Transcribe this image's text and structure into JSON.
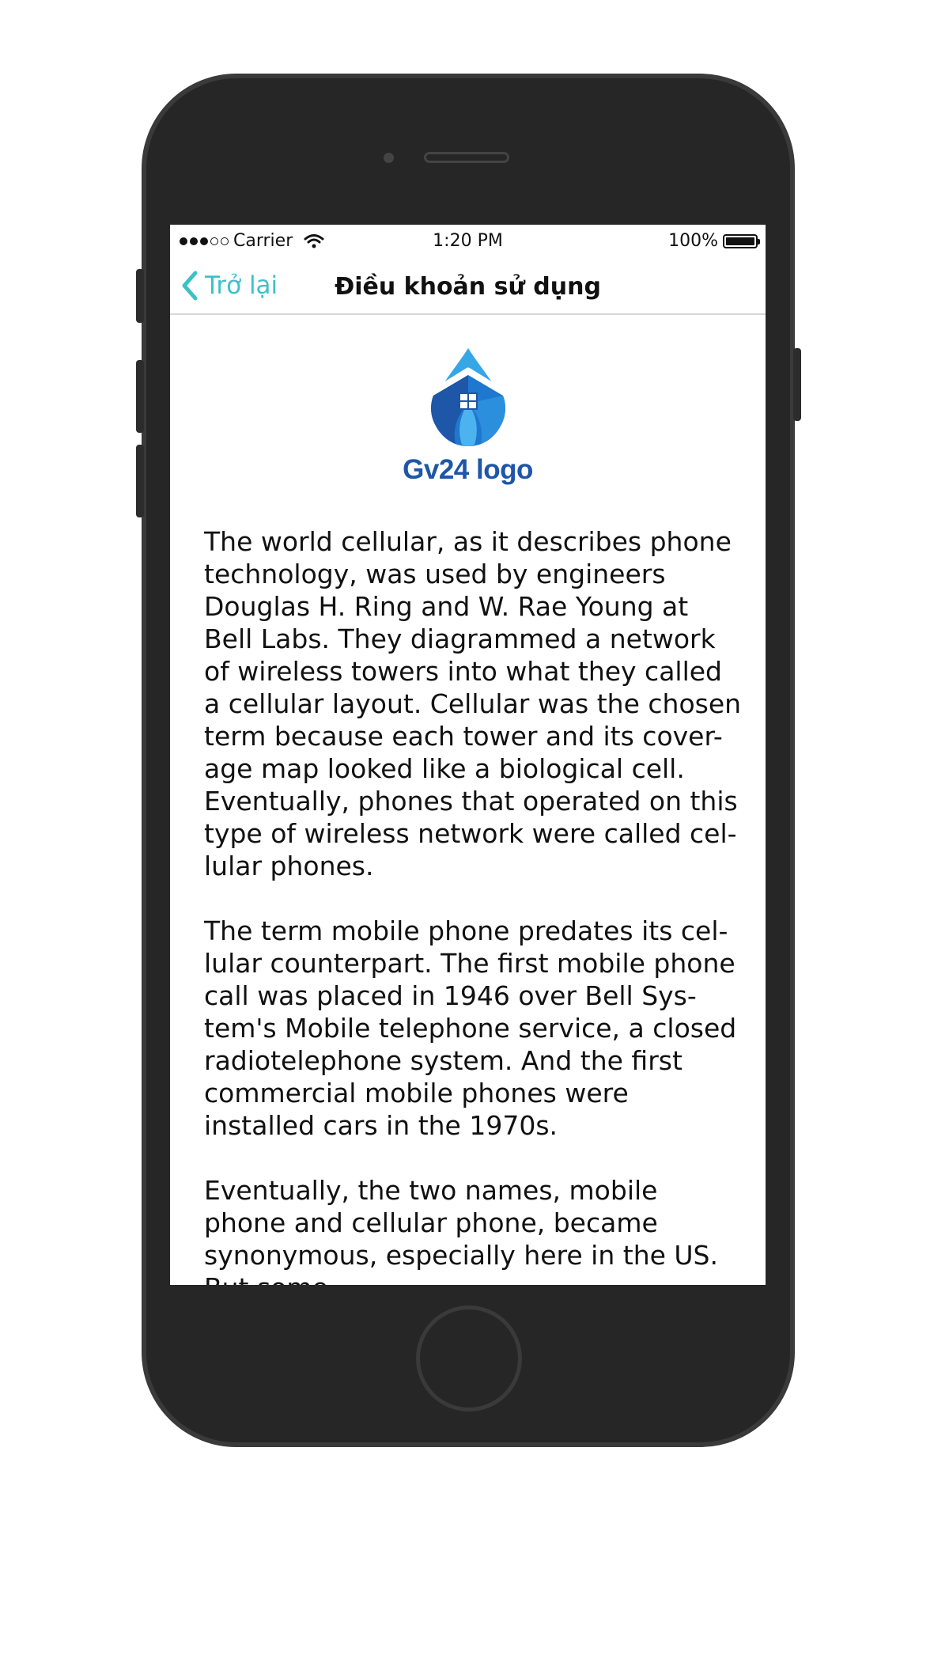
{
  "status_bar": {
    "carrier": "Carrier",
    "time": "1:20 PM",
    "battery": "100%"
  },
  "nav": {
    "back_label": "Trở lại",
    "title": "Điều khoản sử dụng"
  },
  "logo": {
    "text": "Gv24 logo",
    "colors": {
      "primary": "#1e56a8",
      "light": "#35a7e6",
      "mid": "#1f78cf"
    }
  },
  "article": {
    "paragraphs": [
      "The world cellular, as it describes phone technology, was used by engineers Douglas H. Ring and W. Rae Young at Bell Labs. They diagrammed a network of wireless towers into what they called a cellular layout. Cellular was the chosen term because each tower and its cover-age map looked like a biological cell. Eventually, phones that operated on this type of wireless network were called cel-lular phones.",
      "The term mobile phone predates its cel-lular counterpart. The first mobile phone call was placed in 1946 over Bell Sys-tem's Mobile telephone service, a closed radiotelephone system. And the first commercial mobile phones were installed cars in the 1970s.",
      "Eventually, the two names, mobile phone and cellular phone, became synonymous, especially here in the US. But some"
    ]
  },
  "theme": {
    "accent": "#3cc1c8",
    "device_body": "#262626"
  }
}
